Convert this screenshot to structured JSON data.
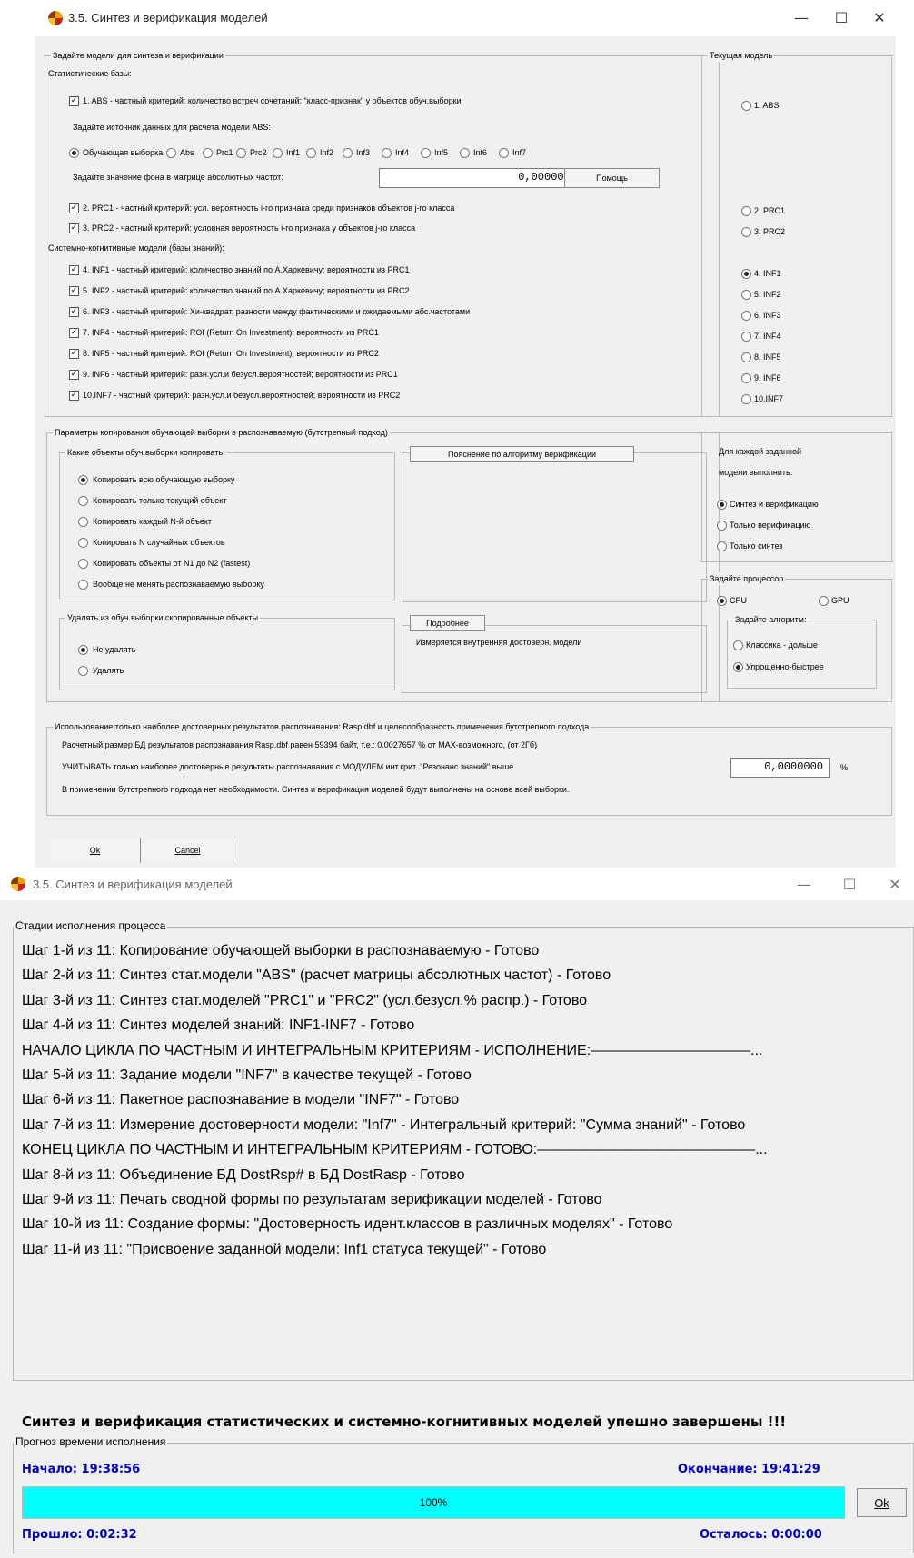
{
  "window1": {
    "title": "3.5. Синтез и верификация моделей",
    "models_group": {
      "legend": "Задайте модели для синтеза и верификации",
      "stat_bases_label": "Статистические базы:",
      "abs_label": "1. ABS  - частный критерий: количество встреч сочетаний: \"класс-признак\" у объектов обуч.выборки",
      "source_label": "Задайте источник данных для расчета модели ABS:",
      "sources": [
        "Обучающая выборка",
        "Abs",
        "Prc1",
        "Prc2",
        "Inf1",
        "Inf2",
        "Inf3",
        "Inf4",
        "Inf5",
        "Inf6",
        "Inf7"
      ],
      "background_label": "Задайте значение фона в матрице абсолютных частот:",
      "background_value": "0,0000000",
      "help_button": "Помощь",
      "prc1_label": "2. PRC1 - частный критерий: усл. вероятность i-го признака среди признаков объектов j-го класса",
      "prc2_label": "3. PRC2 - частный критерий: условная вероятность i-го признака у объектов j-го класса",
      "cognitive_label": "Системно-когнитивные модели (базы знаний):",
      "inf_labels": [
        "4. INF1 - частный критерий: количество знаний по А.Харкевичу; вероятности из PRC1",
        "5. INF2 - частный критерий: количество знаний по А.Харкевичу; вероятности из PRC2",
        "6. INF3 - частный критерий: Хи-квадрат, разности между фактическими и ожидаемыми абс.частотами",
        "7. INF4 - частный критерий: ROI (Return On Investment); вероятности из PRC1",
        "8. INF5 - частный критерий: ROI (Return On Investment); вероятности из PRC2",
        "9. INF6 - частный критерий: разн.усл.и безусл.вероятностей; вероятности из PRC1",
        "10.INF7 - частный критерий: разн.усл.и безусл.вероятностей; вероятности из PRC2"
      ]
    },
    "current_model": {
      "legend": "Текущая модель",
      "options": [
        "1. ABS",
        "2. PRC1",
        "3. PRC2",
        "4. INF1",
        "5. INF2",
        "6. INF3",
        "7. INF4",
        "8. INF5",
        "9. INF6",
        "10.INF7"
      ],
      "selected": "4. INF1"
    },
    "copy_params": {
      "legend": "Параметры копирования обучающей выборки в распознаваемую (бутстрепный подход)",
      "which_legend": "Какие объекты обуч.выборки копировать:",
      "which_options": [
        "Копировать всю обучающую выборку",
        "Копировать только текущий объект",
        "Копировать каждый N-й объект",
        "Копировать N случайных объектов",
        "Копировать объекты от N1 до N2 (fastest)",
        "Вообще не менять распознаваемую выборку"
      ],
      "explain_button": "Пояснение по алгоритму верификации",
      "delete_legend": "Удалять из обуч.выборки скопированные объекты",
      "delete_options": [
        "Не удалять",
        "Удалять"
      ],
      "more_button": "Подробнее",
      "more_text": "Измеряется внутренняя достоверн. модели"
    },
    "per_model": {
      "caption_1": "Для каждой заданной",
      "caption_2": "модели выполнить:",
      "options": [
        "Синтез и верификацию",
        "Только   верификацию",
        "Только   синтез"
      ]
    },
    "processor": {
      "legend": "Задайте процессор",
      "options": [
        "CPU",
        "GPU"
      ],
      "algorithm_legend": "Задайте алгоритм:",
      "algorithm_options": [
        "Классика  - дольше",
        "Упрощенно-быстрее"
      ]
    },
    "reliable": {
      "legend": "Использование только наиболее достоверных результатов распознавания: Rasp.dbf и целесообразность применения бутстрепного подхода",
      "line1": "Расчетный размер БД результатов распознавания Rasp.dbf равен 59394 байт, т.е.: 0.0027657 % от MAX-возможного, (от 2Гб)",
      "line2": "УЧИТЫВАТЬ только наиболее достоверные результаты распознавания с МОДУЛЕМ инт.крит. \"Резонанс знаний\" выше",
      "threshold": "0,0000000",
      "percent": "%",
      "line3": "В применении бутстрепного подхода нет необходимости. Синтез и верификация моделей будут выполнены на основе всей выборки."
    },
    "ok_button": "Ok",
    "cancel_button": "Cancel"
  },
  "window2": {
    "title": "3.5. Синтез и верификация моделей",
    "stages_legend": "Стадии исполнения процесса",
    "stages": [
      "Шаг 1-й из 11: Копирование обучающей выборки в распознаваемую - Готово",
      "Шаг 2-й из 11: Синтез стат.модели \"ABS\" (расчет матрицы абсолютных частот) - Готово",
      "Шаг 3-й из 11: Синтез стат.моделей \"PRC1\" и \"PRC2\" (усл.безусл.% распр.) - Готово",
      "Шаг 4-й из 11: Синтез моделей знаний: INF1-INF7 - Готово",
      "НАЧАЛО ЦИКЛА ПО ЧАСТНЫМ И ИНТЕГРАЛЬНЫМ КРИТЕРИЯМ - ИСПОЛНЕНИЕ:———————————...",
      "Шаг 5-й из 11: Задание модели \"INF7\" в качестве текущей - Готово",
      "Шаг 6-й из 11: Пакетное распознавание в модели \"INF7\" - Готово",
      "Шаг 7-й из 11: Измерение достоверности модели: \"Inf7\" - Интегральный критерий: \"Сумма знаний\" - Готово",
      "КОНЕЦ ЦИКЛА ПО ЧАСТНЫМ И ИНТЕГРАЛЬНЫМ КРИТЕРИЯМ - ГОТОВО:———————————————...",
      "Шаг 8-й из 11: Объединение БД DostRsp# в БД DostRasp - Готово",
      "Шаг 9-й из 11: Печать сводной формы по результатам верификации моделей - Готово",
      "Шаг 10-й из 11: Создание формы: \"Достоверность идент.классов в различных моделях\" - Готово",
      "Шаг 11-й из 11: \"Присвоение заданной модели: Inf1 статуса текущей\" - Готово"
    ],
    "success_message": "Синтез и верификация статистических и системно-когнитивных моделей упешно завершены !!!",
    "forecast_legend": "Прогноз времени исполнения",
    "start_label": "Начало: 19:38:56",
    "end_label": "Окончание: 19:41:29",
    "progress_value": 1.0,
    "progress_text": "100%",
    "elapsed_label": "Прошло: 0:02:32",
    "remaining_label": "Осталось: 0:00:00",
    "ok_button": "Ok",
    "colors": {
      "progress_fill": "#00ffff",
      "time_labels": "#0000c0"
    }
  }
}
